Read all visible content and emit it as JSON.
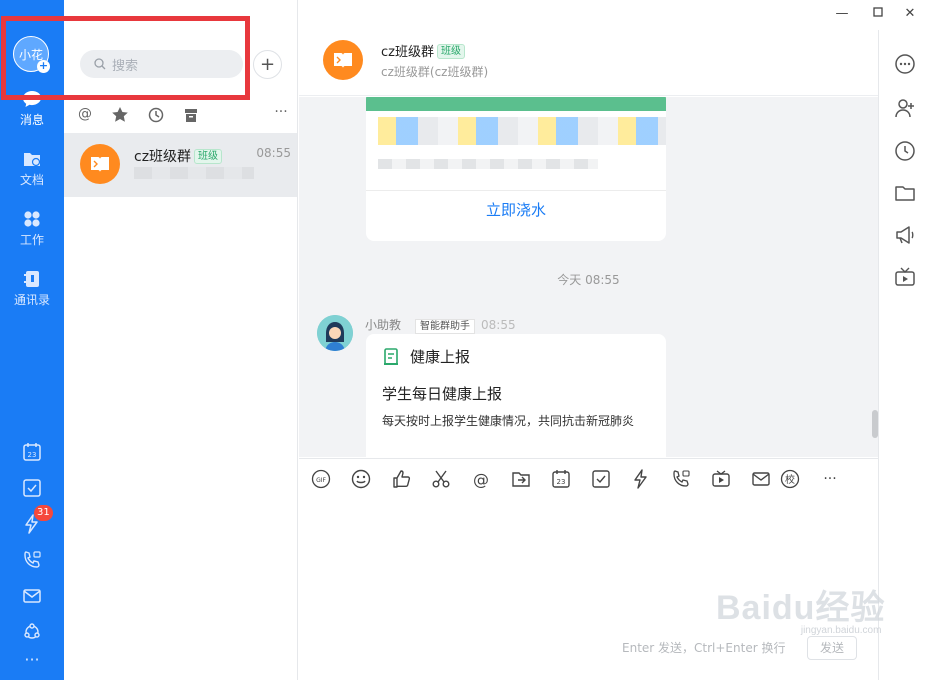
{
  "nav": {
    "avatar_text": "小花",
    "items": [
      {
        "label": "消息",
        "icon": "message-icon"
      },
      {
        "label": "文档",
        "icon": "document-icon"
      },
      {
        "label": "工作",
        "icon": "work-icon"
      },
      {
        "label": "通讯录",
        "icon": "contacts-icon"
      }
    ],
    "badge_count": "31"
  },
  "search": {
    "placeholder": "搜索"
  },
  "conversation": {
    "name": "cz班级群",
    "tag": "班级",
    "time": "08:55"
  },
  "chat": {
    "group_name": "cz班级群",
    "group_tag": "班级",
    "group_subtitle": "cz班级群(cz班级群)",
    "card1_button": "立即浇水",
    "time_separator": "今天 08:55",
    "bot_name": "小助教",
    "bot_tag": "智能群助手",
    "bot_time": "08:55",
    "card2_header": "健康上报",
    "card2_title": "学生每日健康上报",
    "card2_desc": "每天按时上报学生健康情况，共同抗击新冠肺炎"
  },
  "input": {
    "hint": "Enter 发送，Ctrl+Enter 换行",
    "send_label": "发送"
  },
  "watermark": {
    "text": "Baidu经验",
    "sub": "jingyan.baidu.com"
  },
  "colors": {
    "nav_bg": "#1a7cf5",
    "accent": "#1a7cf5",
    "tag_green": "#2aa86b",
    "highlight_box": "#e8383d"
  }
}
